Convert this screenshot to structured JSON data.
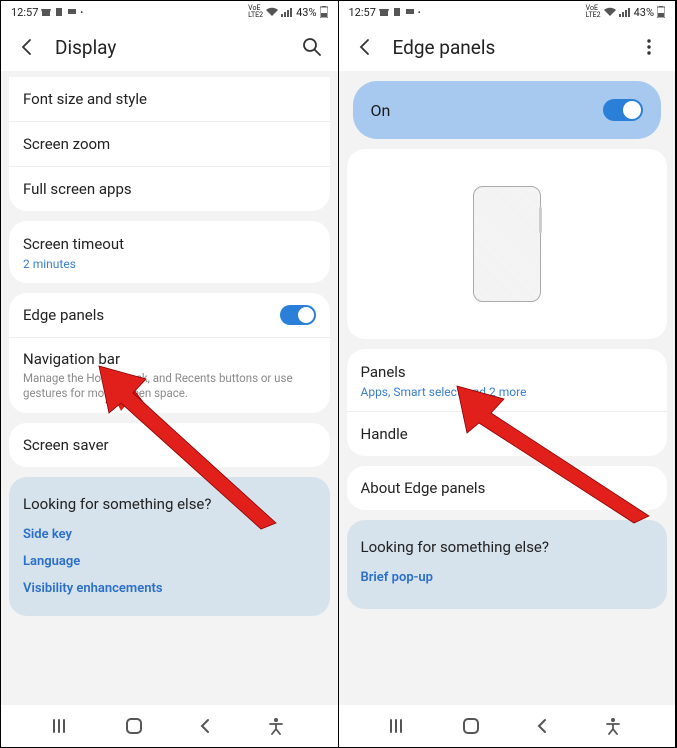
{
  "statusbar": {
    "time": "12:57",
    "battery": "43%"
  },
  "left_screen": {
    "title": "Display",
    "rows": {
      "font": "Font size and style",
      "zoom": "Screen zoom",
      "fullscreen": "Full screen apps",
      "timeout": "Screen timeout",
      "timeout_sub": "2 minutes",
      "edge": "Edge panels",
      "nav": "Navigation bar",
      "nav_desc": "Manage the Home, Back, and Recents buttons or use gestures for more screen space.",
      "saver": "Screen saver"
    },
    "looking": {
      "hdr": "Looking for something else?",
      "l1": "Side key",
      "l2": "Language",
      "l3": "Visibility enhancements"
    }
  },
  "right_screen": {
    "title": "Edge panels",
    "on_label": "On",
    "rows": {
      "panels": "Panels",
      "panels_sub": "Apps, Smart select, and 2 more",
      "handle": "Handle",
      "about": "About Edge panels"
    },
    "looking": {
      "hdr": "Looking for something else?",
      "l1": "Brief pop-up"
    }
  }
}
